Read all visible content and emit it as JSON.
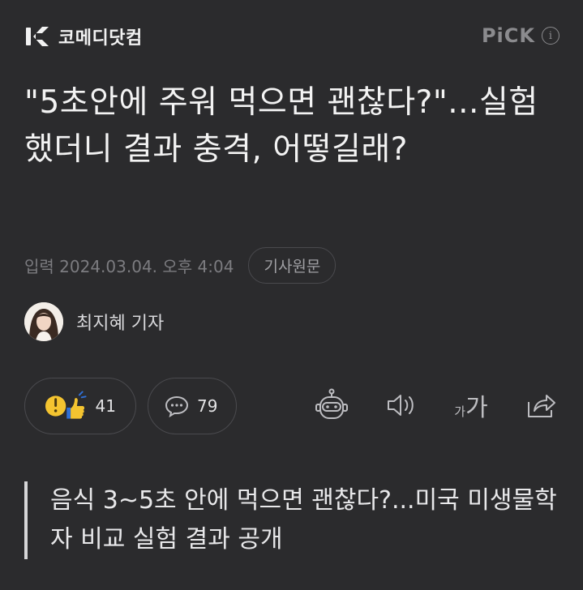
{
  "header": {
    "logo_text": "코메디닷컴",
    "pick_label": "PiCK",
    "info_glyph": "i"
  },
  "article": {
    "title": "\"5초안에 주워 먹으면 괜찮다?\"...실험했더니 결과 충격, 어떻길래?",
    "date": "입력 2024.03.04. 오후 4:04",
    "source_button": "기사원문",
    "author": "최지혜 기자",
    "summary": "음식 3~5초 안에 먹으면 괜찮다?...미국 미생물학자 비교 실험 결과 공개"
  },
  "reactions": {
    "like_count": "41",
    "comment_count": "79"
  },
  "toolbar": {
    "font_small": "가",
    "font_large": "가"
  },
  "colors": {
    "background": "#2b2b2d",
    "accent_yellow": "#f4c430",
    "muted": "#7c7c80"
  },
  "icons": [
    "komedi-logo-icon",
    "info-icon",
    "like-emoji-icon",
    "comment-icon",
    "robot-icon",
    "speaker-icon",
    "font-size-icon",
    "share-icon"
  ]
}
